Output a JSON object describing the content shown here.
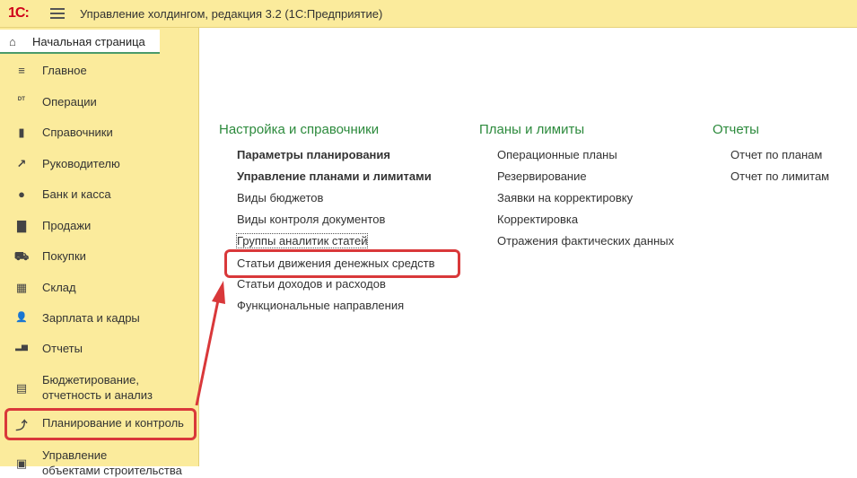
{
  "titlebar": {
    "logo": "1С:",
    "title": "Управление холдингом, редакция 3.2  (1С:Предприятие)"
  },
  "home_tab": {
    "label": "Начальная страница",
    "icon": "home-icon"
  },
  "sidebar": {
    "items": [
      {
        "label": "Главное",
        "icon": "menu-lines-icon",
        "glyph": "≡"
      },
      {
        "label": "Операции",
        "icon": "dt-kt-icon",
        "glyph": "ᴰᵀ"
      },
      {
        "label": "Справочники",
        "icon": "book-icon",
        "glyph": "▮"
      },
      {
        "label": "Руководителю",
        "icon": "trend-icon",
        "glyph": "↗"
      },
      {
        "label": "Банк и касса",
        "icon": "coin-icon",
        "glyph": "●"
      },
      {
        "label": "Продажи",
        "icon": "bag-icon",
        "glyph": "▇"
      },
      {
        "label": "Покупки",
        "icon": "cart-icon",
        "glyph": "⛟"
      },
      {
        "label": "Склад",
        "icon": "warehouse-icon",
        "glyph": "▦"
      },
      {
        "label": "Зарплата и кадры",
        "icon": "person-icon",
        "glyph": "👤"
      },
      {
        "label": "Отчеты",
        "icon": "bar-chart-icon",
        "glyph": "▂▅"
      },
      {
        "label": "Бюджетирование,",
        "label2": "отчетность и анализ",
        "icon": "budget-icon",
        "glyph": "▤"
      },
      {
        "label": "Планирование и контроль",
        "icon": "planning-icon",
        "glyph": "⤴"
      },
      {
        "label": "Управление",
        "label2": "объектами строительства",
        "icon": "building-icon",
        "glyph": "▣"
      }
    ]
  },
  "sections": {
    "setup": {
      "title": "Настройка и справочники",
      "links": [
        "Параметры планирования",
        "Управление планами и лимитами",
        "Виды бюджетов",
        "Виды контроля документов",
        "Группы аналитик статей",
        "Статьи движения денежных средств",
        "Статьи доходов и расходов",
        "Функциональные направления"
      ]
    },
    "plans": {
      "title": "Планы и лимиты",
      "links": [
        "Операционные планы",
        "Резервирование",
        "Заявки на корректировку",
        "Корректировка",
        "Отражения фактических данных"
      ]
    },
    "reports": {
      "title": "Отчеты",
      "links": [
        "Отчет по планам",
        "Отчет по лимитам"
      ]
    }
  },
  "colors": {
    "titlebar_bg": "#fbeb9c",
    "section_title": "#2c8a3c",
    "highlight": "#d9383a"
  }
}
